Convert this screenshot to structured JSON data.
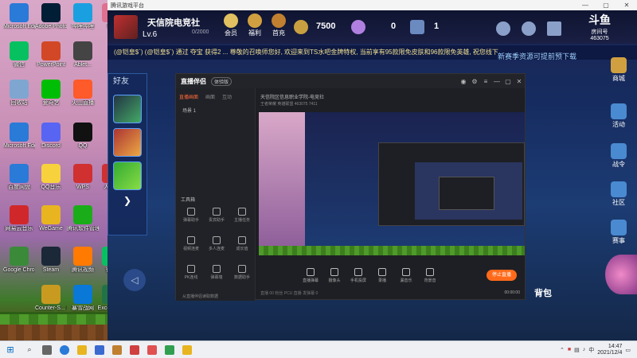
{
  "desktop": {
    "icons": [
      {
        "label": "Microsoft Edge",
        "color": "#2a7ad8"
      },
      {
        "label": "Adobe Photosh...",
        "color": "#001e36"
      },
      {
        "label": "哔哩哔哩",
        "color": "#1aa0e0"
      },
      {
        "label": "SAI",
        "color": "#e07090"
      },
      {
        "label": "微信",
        "color": "#07c160"
      },
      {
        "label": "PowerPoint",
        "color": "#d24726"
      },
      {
        "label": "Ablet...",
        "color": "#444444"
      },
      {
        "label": "回收站",
        "color": "#7fa6d0"
      },
      {
        "label": "爱奇艺",
        "color": "#00be06"
      },
      {
        "label": "火山直播",
        "color": "#ff5a2a"
      },
      {
        "label": "Microsoft Edge",
        "color": "#2a7ad8"
      },
      {
        "label": "Discord",
        "color": "#5865f2"
      },
      {
        "label": "QQ",
        "color": "#111111"
      },
      {
        "label": "百度网盘",
        "color": "#2a7ad8"
      },
      {
        "label": "QQ音乐",
        "color": "#f7d23d"
      },
      {
        "label": "WPS",
        "color": "#d03030"
      },
      {
        "label": "人民...",
        "color": "#d03030"
      },
      {
        "label": "网易云音乐",
        "color": "#d0282a"
      },
      {
        "label": "WeGame",
        "color": "#e8b520"
      },
      {
        "label": "腾讯软件管理",
        "color": "#1aad19"
      },
      {
        "label": "Google Chrome",
        "color": "#3a8a3a"
      },
      {
        "label": "Steam",
        "color": "#1b2838"
      },
      {
        "label": "腾讯视频",
        "color": "#ff7a00"
      },
      {
        "label": "微信",
        "color": "#07c160"
      },
      {
        "label": "Counter-S... Global Off...",
        "color": "#c89a20"
      },
      {
        "label": "暴雪战网",
        "color": "#0a78d6"
      },
      {
        "label": "Excel 2013",
        "color": "#217346"
      }
    ]
  },
  "client": {
    "title": "腾讯游戏平台",
    "user_name": "天信院电竞社",
    "level": "Lv.6",
    "exp": "0/2000",
    "top_icons": [
      "会员",
      "福利",
      "首充"
    ],
    "coin_value": "7500",
    "gem_value": "0",
    "card_value": "1",
    "top_right": [
      "好友",
      "消息",
      "邮件"
    ],
    "broadcast": "(@铠皇$`) (@铠皇$`) 通过 夺宝 获得2 ... 尊敬的召唤师您好, 欢迎来到TS水吧金牌特权, 当前享有95款限免皮肤和96款限免英雄, 祝您线下",
    "notice": "新赛季资源可提前预下载",
    "friends_label": "好友",
    "side_buttons": [
      "商城",
      "活动",
      "战令",
      "社区",
      "赛事"
    ],
    "room_id_label": "房间号",
    "room_id": "463075",
    "backpack": "背包"
  },
  "stream": {
    "app_name": "直播伴侣",
    "tag": "体验版",
    "tabs": [
      "直播画面",
      "画面",
      "互动"
    ],
    "scene": "场景 1",
    "info": "天信院区信息职业学院-电竞社",
    "info2": "王者荣耀  英雄联盟  463075  7411",
    "tools_header": "工具箱",
    "tools": [
      "弹幕助手",
      "贵宾助手",
      "主播任务",
      "视频连麦",
      "多人连麦",
      "成长值",
      "PK连线",
      "弹幕墙",
      "数据助手"
    ],
    "bottom_buttons": [
      "直播弹幕",
      "摄像头",
      "手机投屏",
      "录播",
      "漏音乐",
      "背景音"
    ],
    "go_live": "停止直播",
    "stats": "直播 00   粉丝  PCU  直播   发弹幕 0",
    "timer": "00:00:00",
    "footer": "从直播伴侣读取数据"
  },
  "taskbar": {
    "start_icon": "windows-start-icon",
    "clock_time": "14:47",
    "clock_date": "2021/12/4",
    "lang": "中"
  }
}
